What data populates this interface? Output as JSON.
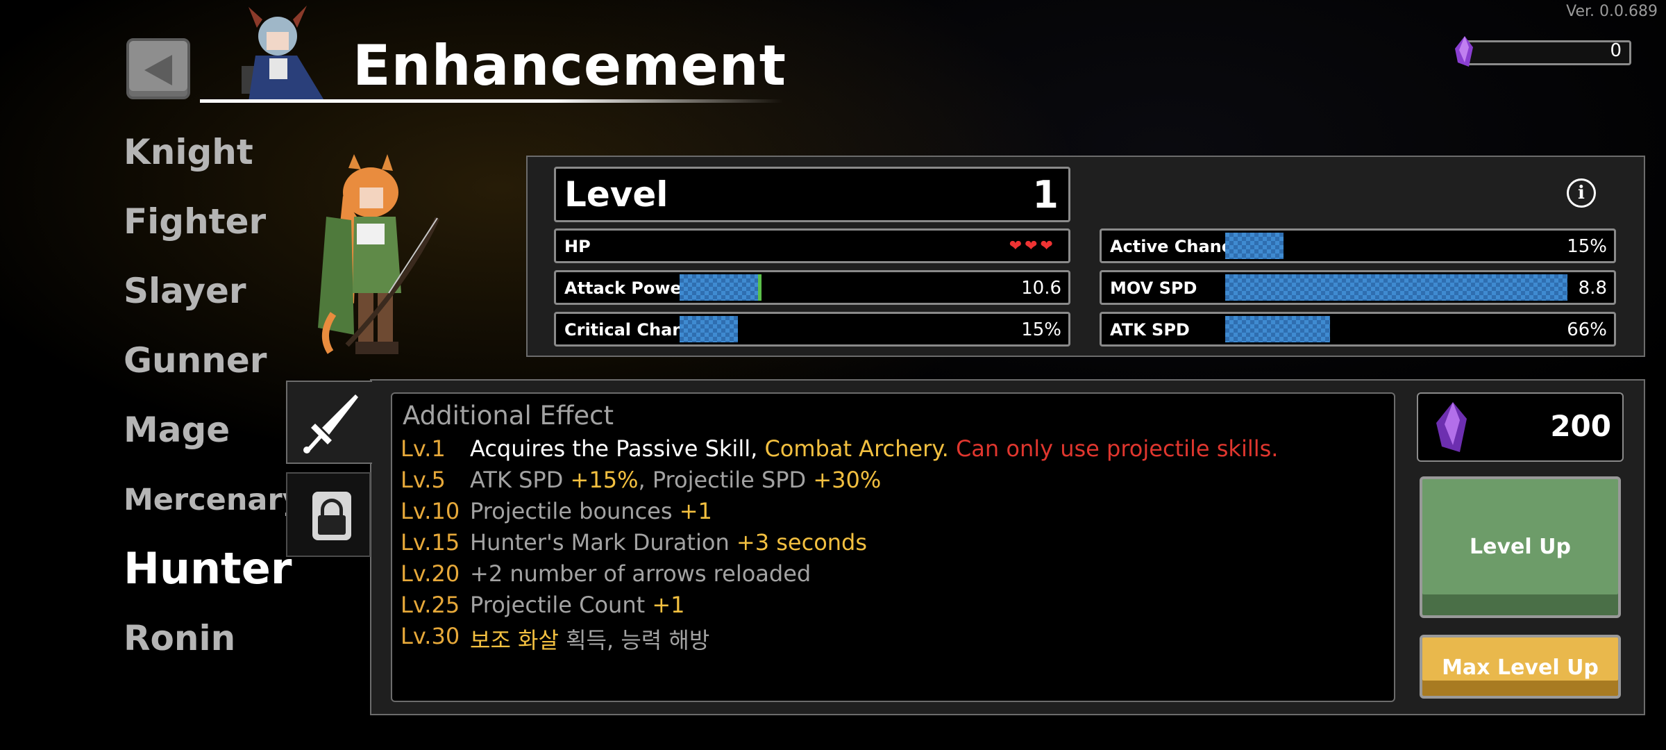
{
  "version": "Ver. 0.0.689",
  "header": {
    "title": "Enhancement",
    "currency_value": "0"
  },
  "classes": [
    {
      "label": "Knight",
      "selected": false
    },
    {
      "label": "Fighter",
      "selected": false
    },
    {
      "label": "Slayer",
      "selected": false
    },
    {
      "label": "Gunner",
      "selected": false
    },
    {
      "label": "Mage",
      "selected": false
    },
    {
      "label": "Mercenary",
      "selected": false
    },
    {
      "label": "Hunter",
      "selected": true
    },
    {
      "label": "Ronin",
      "selected": false
    }
  ],
  "stats": {
    "level_label": "Level",
    "level_value": "1",
    "hp_label": "HP",
    "hp_hearts": 3,
    "attack_power": {
      "label": "Attack Power",
      "value": "10.6",
      "fill": 0.21
    },
    "critical_chance": {
      "label": "Critical Chance",
      "value": "15%",
      "fill": 0.15
    },
    "active_chance": {
      "label": "Active Chance",
      "value": "15%",
      "fill": 0.15
    },
    "mov_spd": {
      "label": "MOV SPD",
      "value": "8.8",
      "fill": 0.88
    },
    "atk_spd": {
      "label": "ATK SPD",
      "value": "66%",
      "fill": 0.27
    }
  },
  "effects": {
    "title": "Additional Effect",
    "rows": [
      {
        "lv": "Lv.1",
        "parts": [
          {
            "t": "Acquires the Passive Skill, ",
            "c": "white"
          },
          {
            "t": "Combat Archery.",
            "c": "gold"
          },
          {
            "t": " Can only use projectile skills.",
            "c": "red"
          }
        ]
      },
      {
        "lv": "Lv.5",
        "parts": [
          {
            "t": "ATK SPD ",
            "c": "gray"
          },
          {
            "t": "+15%",
            "c": "gold"
          },
          {
            "t": ", Projectile SPD ",
            "c": "gray"
          },
          {
            "t": "+30%",
            "c": "gold"
          }
        ]
      },
      {
        "lv": "Lv.10",
        "parts": [
          {
            "t": "Projectile bounces ",
            "c": "gray"
          },
          {
            "t": "+1",
            "c": "gold"
          }
        ]
      },
      {
        "lv": "Lv.15",
        "parts": [
          {
            "t": "Hunter's Mark Duration ",
            "c": "gray"
          },
          {
            "t": "+3 seconds",
            "c": "gold"
          }
        ]
      },
      {
        "lv": "Lv.20",
        "parts": [
          {
            "t": "+2 number of arrows reloaded",
            "c": "gray"
          }
        ]
      },
      {
        "lv": "Lv.25",
        "parts": [
          {
            "t": "Projectile Count ",
            "c": "gray"
          },
          {
            "t": "+1",
            "c": "gold"
          }
        ]
      },
      {
        "lv": "Lv.30",
        "parts": [
          {
            "t": "보조 화살",
            "c": "gold"
          },
          {
            "t": " 획득, 능력 해방",
            "c": "gray"
          }
        ]
      }
    ]
  },
  "upgrade": {
    "cost": "200",
    "level_up_label": "Level Up",
    "max_level_up_label": "Max Level Up"
  },
  "colors": {
    "accent_gold": "#f3c040",
    "warning_red": "#e0362e",
    "level_up_green": "#6d9c69",
    "max_level_gold": "#e9b84c"
  },
  "icons": [
    "back-arrow-icon",
    "purple-gem-icon",
    "info-icon",
    "sword-icon",
    "lock-icon",
    "heart-icon"
  ]
}
